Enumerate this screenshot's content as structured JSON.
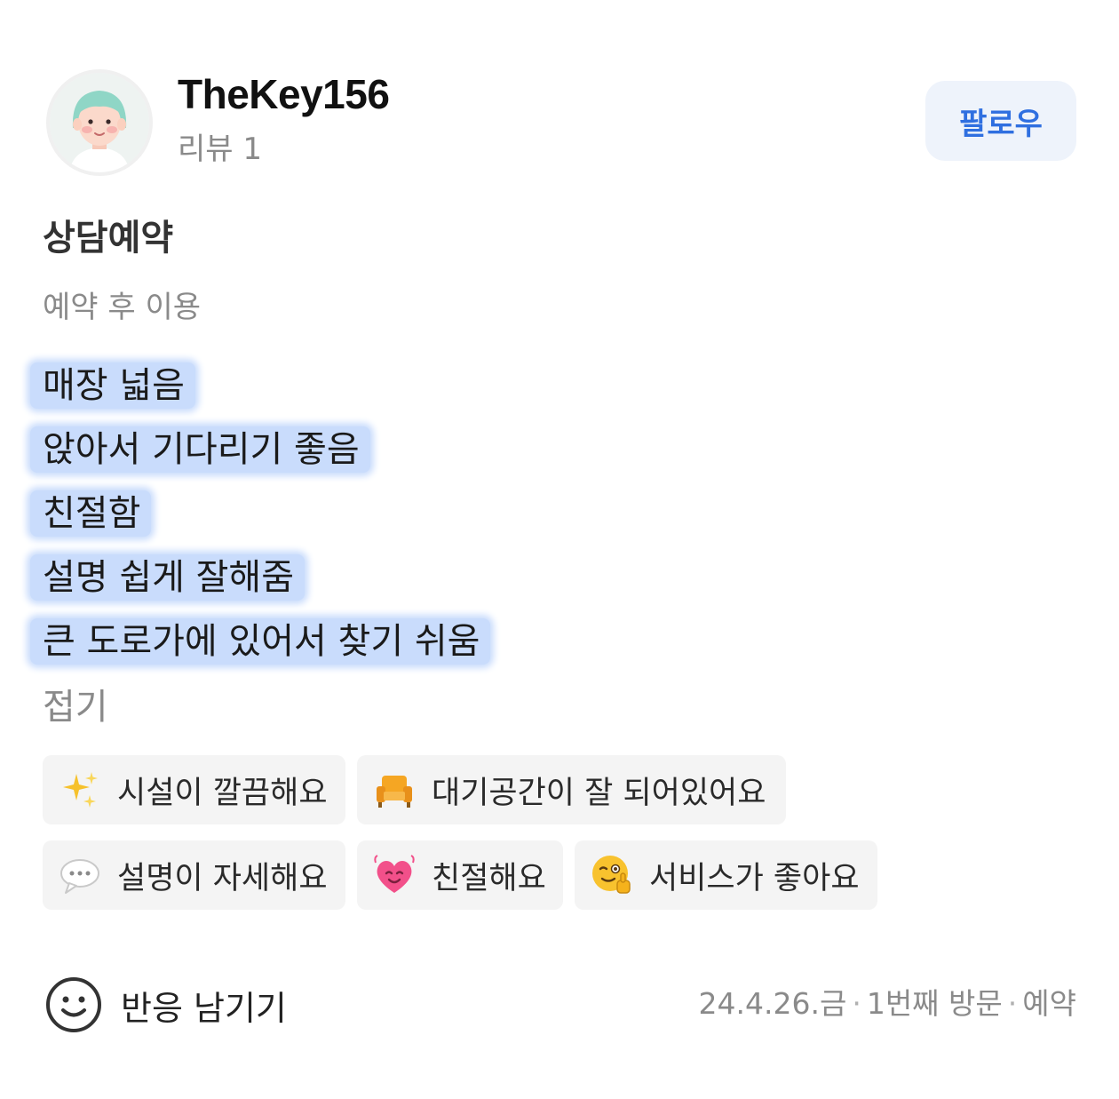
{
  "profile": {
    "username": "TheKey156",
    "review_count": "리뷰 1",
    "follow_label": "팔로우"
  },
  "review": {
    "title": "상담예약",
    "visit_type": "예약 후 이용",
    "lines": [
      "매장 넓음",
      "앉아서 기다리기 좋음",
      "친절함",
      "설명 쉽게 잘해줌",
      "큰 도로가에 있어서 찾기 쉬움"
    ],
    "collapse_label": "접기"
  },
  "keywords": [
    {
      "icon": "sparkles-icon",
      "label": "시설이 깔끔해요"
    },
    {
      "icon": "armchair-icon",
      "label": "대기공간이 잘 되어있어요"
    },
    {
      "icon": "speech-bubble-icon",
      "label": "설명이 자세해요"
    },
    {
      "icon": "heart-icon",
      "label": "친절해요"
    },
    {
      "icon": "wink-thumbs-up-icon",
      "label": "서비스가 좋아요"
    }
  ],
  "footer": {
    "react_label": "반응 남기기",
    "visit_date": "24.4.26.금",
    "visit_count": "1번째 방문",
    "visit_method": "예약"
  },
  "colors": {
    "highlight": "#c9dcfc",
    "follow_text": "#2f6fe0",
    "follow_bg": "#eef3fb",
    "chip_bg": "#f4f4f4",
    "muted_text": "#8a8a8a"
  }
}
